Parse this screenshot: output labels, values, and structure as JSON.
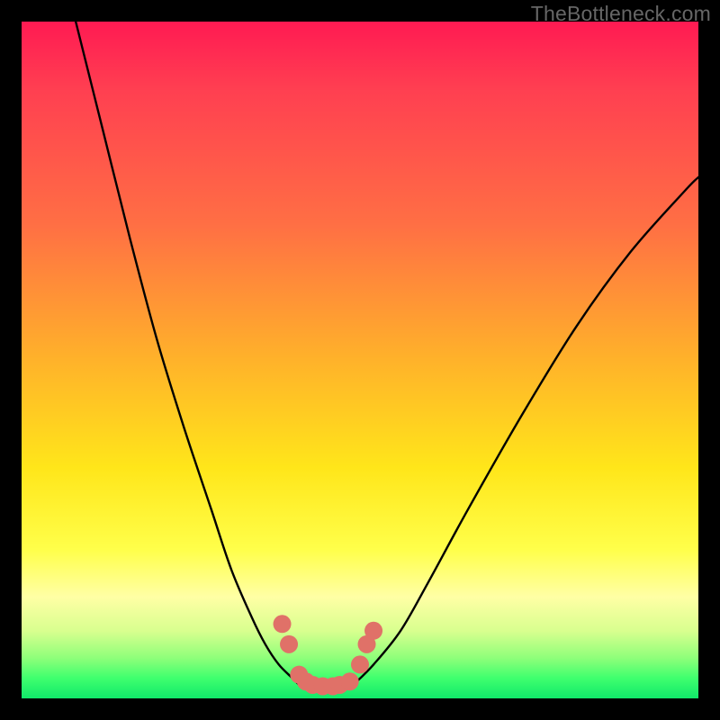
{
  "watermark": "TheBottleneck.com",
  "chart_data": {
    "type": "line",
    "title": "",
    "xlabel": "",
    "ylabel": "",
    "xlim": [
      0,
      100
    ],
    "ylim": [
      0,
      100
    ],
    "annotations": [],
    "series": [
      {
        "name": "left-curve",
        "x": [
          8,
          12,
          16,
          20,
          24,
          28,
          31,
          34,
          36,
          38,
          40,
          41
        ],
        "y": [
          100,
          84,
          68,
          53,
          40,
          28,
          19,
          12,
          8,
          5,
          3,
          2
        ]
      },
      {
        "name": "valley-floor",
        "x": [
          41,
          43,
          45,
          47,
          49
        ],
        "y": [
          2,
          1.5,
          1.5,
          1.5,
          2
        ]
      },
      {
        "name": "right-curve",
        "x": [
          49,
          52,
          56,
          60,
          66,
          74,
          82,
          90,
          98,
          100
        ],
        "y": [
          2,
          5,
          10,
          17,
          28,
          42,
          55,
          66,
          75,
          77
        ]
      }
    ],
    "markers": {
      "name": "valley-dots",
      "color": "#e07168",
      "points": [
        {
          "x": 38.5,
          "y": 11
        },
        {
          "x": 39.5,
          "y": 8
        },
        {
          "x": 41,
          "y": 3.5
        },
        {
          "x": 42,
          "y": 2.5
        },
        {
          "x": 43,
          "y": 2
        },
        {
          "x": 44.5,
          "y": 1.8
        },
        {
          "x": 46,
          "y": 1.8
        },
        {
          "x": 47,
          "y": 2
        },
        {
          "x": 48.5,
          "y": 2.5
        },
        {
          "x": 50,
          "y": 5
        },
        {
          "x": 51,
          "y": 8
        },
        {
          "x": 52,
          "y": 10
        }
      ]
    }
  }
}
